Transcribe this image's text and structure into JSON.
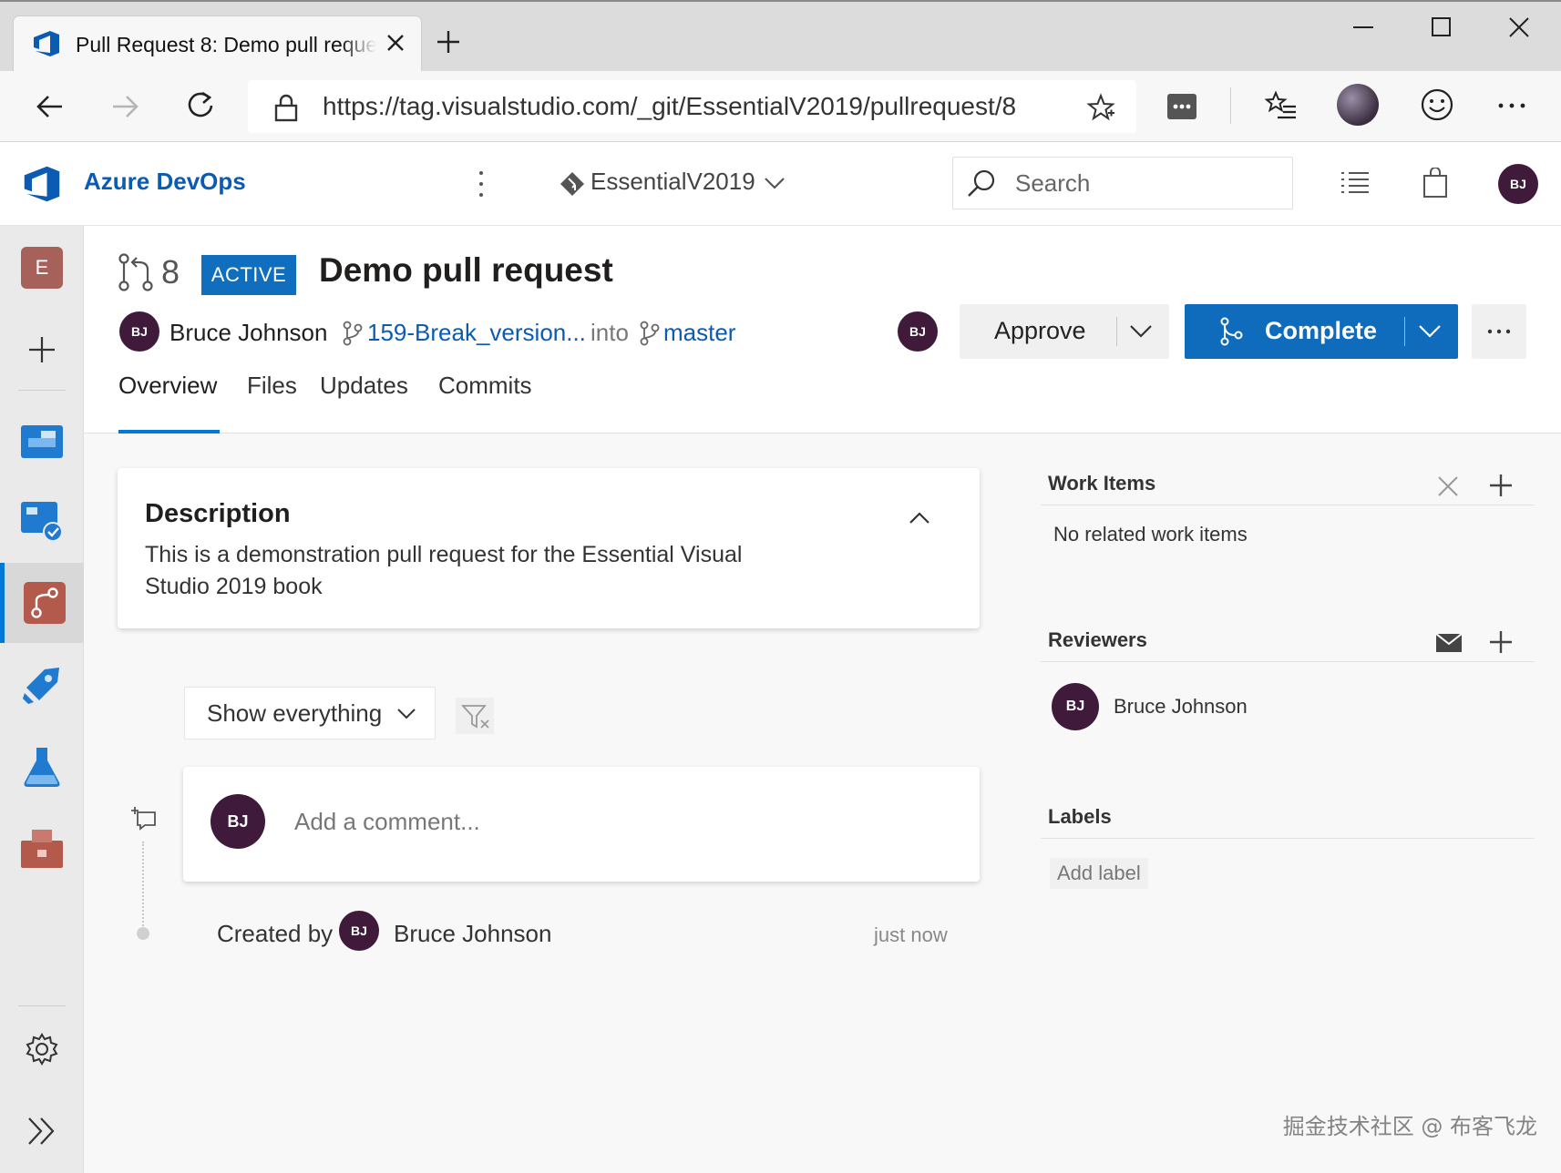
{
  "browser": {
    "tab_title": "Pull Request 8: Demo pull request - Azure DevOps",
    "url": "https://tag.visualstudio.com/_git/EssentialV2019/pullrequest/8"
  },
  "header": {
    "brand": "Azure DevOps",
    "project": "EssentialV2019",
    "search_placeholder": "Search",
    "user_initials": "BJ"
  },
  "nav": {
    "org_letter": "E"
  },
  "pr": {
    "number": "8",
    "status": "ACTIVE",
    "title": "Demo pull request",
    "author": "Bruce Johnson",
    "author_initials": "BJ",
    "source_branch": "159-Break_version...",
    "into": "into",
    "target_branch": "master",
    "reviewer_initials": "BJ",
    "approve_label": "Approve",
    "complete_label": "Complete",
    "tabs": [
      "Overview",
      "Files",
      "Updates",
      "Commits"
    ]
  },
  "description": {
    "heading": "Description",
    "text": "This is a demonstration pull request for the Essential Visual Studio 2019 book"
  },
  "timeline": {
    "filter_label": "Show everything",
    "comment_placeholder": "Add a comment...",
    "commenter_initials": "BJ",
    "created_by_label": "Created by",
    "created_by_initials": "BJ",
    "created_by_name": "Bruce Johnson",
    "created_time": "just now"
  },
  "side": {
    "work_items_heading": "Work Items",
    "work_items_empty": "No related work items",
    "reviewers_heading": "Reviewers",
    "reviewer_name": "Bruce Johnson",
    "reviewer_initials": "BJ",
    "labels_heading": "Labels",
    "add_label": "Add label"
  },
  "watermark": "掘金技术社区 @ 布客飞龙",
  "colors": {
    "accent": "#0078d4",
    "brand": "#0b5bb3",
    "avatar": "#3f1a3a",
    "complete_button": "#0f6cbd"
  }
}
